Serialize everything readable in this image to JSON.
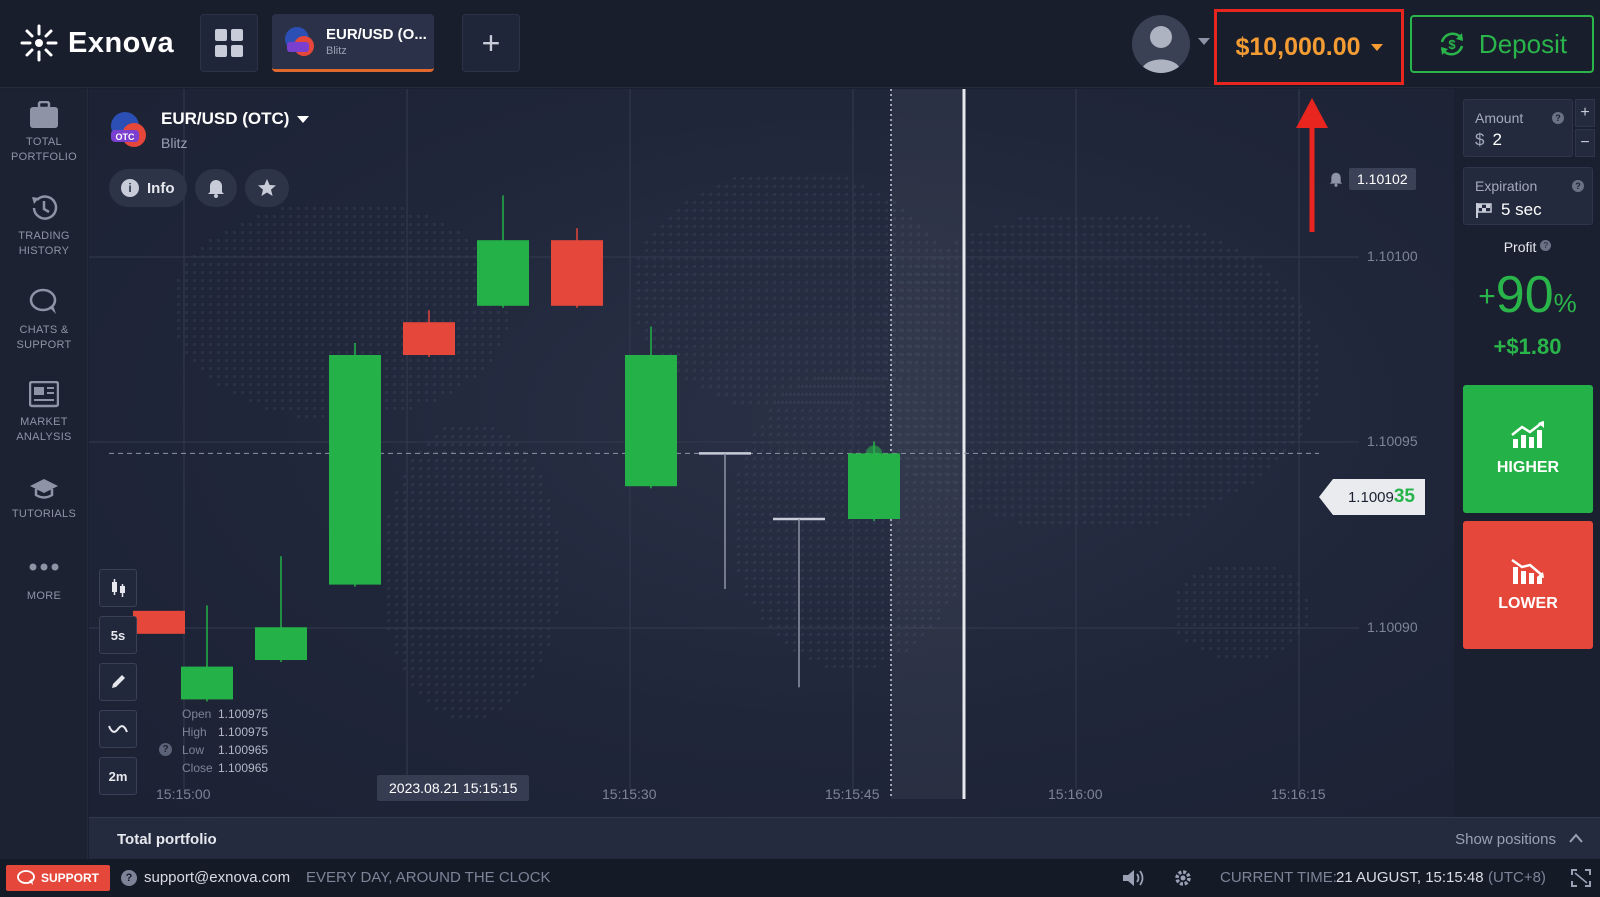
{
  "brand": {
    "name": "Exnova"
  },
  "header": {
    "asset_tab": {
      "name": "EUR/USD (O...",
      "sub": "Blitz",
      "badge": "OTC"
    },
    "balance": "$10,000.00",
    "deposit_label": "Deposit"
  },
  "sidebar": {
    "items": [
      {
        "line1": "TOTAL",
        "line2": "PORTFOLIO",
        "icon": "briefcase-icon"
      },
      {
        "line1": "TRADING",
        "line2": "HISTORY",
        "icon": "history-icon"
      },
      {
        "line1": "CHATS &",
        "line2": "SUPPORT",
        "icon": "chat-icon"
      },
      {
        "line1": "MARKET",
        "line2": "ANALYSIS",
        "icon": "newspaper-icon"
      },
      {
        "line1": "TUTORIALS",
        "line2": "",
        "icon": "graduation-cap-icon"
      },
      {
        "line1": "MORE",
        "line2": "",
        "icon": "more-dots-icon"
      }
    ]
  },
  "chart": {
    "asset_name": "EUR/USD (OTC)",
    "asset_sub": "Blitz",
    "asset_badge": "OTC",
    "info_label": "Info",
    "alert_price": "1.10102",
    "current_price_main": "1.1009",
    "current_price_hl": "35",
    "time_badge": "2023.08.21 15:15:15",
    "tools": {
      "timeframe": "5s",
      "interval": "2m"
    },
    "ohlc": {
      "open_label": "Open",
      "open": "1.100975",
      "high_label": "High",
      "high": "1.100975",
      "low_label": "Low",
      "low": "1.100965",
      "close_label": "Close",
      "close": "1.100965"
    }
  },
  "chart_data": {
    "type": "candlestick",
    "x_ticks": [
      "15:15:00",
      "15:15:15",
      "15:15:30",
      "15:15:45",
      "15:16:00",
      "15:16:15"
    ],
    "y_ticks": [
      "1.10100",
      "1.10095",
      "1.10090"
    ],
    "candles": [
      {
        "open": 1.100887,
        "high": 1.10088,
        "low": 1.100887,
        "close": 1.10088,
        "color": "#e5473a"
      },
      {
        "open": 1.10086,
        "high": 1.100885,
        "low": 1.10086,
        "close": 1.10087,
        "color": "#24b248"
      },
      {
        "open": 1.100872,
        "high": 1.1009,
        "low": 1.100872,
        "close": 1.100882,
        "color": "#24b248"
      },
      {
        "open": 1.100895,
        "high": 1.100965,
        "low": 1.100895,
        "close": 1.100965,
        "color": "#24b248"
      },
      {
        "open": 1.100975,
        "high": 1.100975,
        "low": 1.100965,
        "close": 1.100965,
        "color": "#e5473a"
      },
      {
        "open": 1.10098,
        "high": 1.10101,
        "low": 1.10098,
        "close": 1.101,
        "color": "#24b248"
      },
      {
        "open": 1.101,
        "high": 1.101,
        "low": 1.10098,
        "close": 1.10098,
        "color": "#e5473a"
      },
      {
        "open": 1.100925,
        "high": 1.10097,
        "low": 1.100925,
        "close": 1.100965,
        "color": "#24b248"
      },
      {
        "open": 1.100935,
        "high": 1.100935,
        "low": 1.100915,
        "close": 1.100935,
        "color": "#ffffff"
      },
      {
        "open": 1.100915,
        "high": 1.100915,
        "low": 1.100885,
        "close": 1.100915,
        "color": "#ffffff"
      },
      {
        "open": 1.100915,
        "high": 1.100935,
        "low": 1.100915,
        "close": 1.100935,
        "color": "#24b248"
      }
    ],
    "current_price": 1.100935,
    "alert_price": 1.10102,
    "y_range": [
      1.10084,
      1.10104
    ],
    "grid": true
  },
  "trade": {
    "amount_label": "Amount",
    "amount_currency": "$",
    "amount_value": "2",
    "expiration_label": "Expiration",
    "expiration_value": "5 sec",
    "profit_label": "Profit",
    "profit_sign": "+",
    "profit_pct": "90",
    "profit_pct_unit": "%",
    "profit_amount": "+$1.80",
    "higher_label": "HIGHER",
    "lower_label": "LOWER"
  },
  "portfolio_bar": {
    "title": "Total portfolio",
    "show_positions": "Show positions"
  },
  "status": {
    "support_label": "SUPPORT",
    "email": "support@exnova.com",
    "hours": "EVERY DAY, AROUND THE CLOCK",
    "time_label": "CURRENT TIME:",
    "time_value": "21 AUGUST, 15:15:48",
    "timezone": "(UTC+8)"
  },
  "colors": {
    "green": "#24b248",
    "red": "#e5473a",
    "orange": "#f39c34",
    "highlight": "#e8251e"
  }
}
